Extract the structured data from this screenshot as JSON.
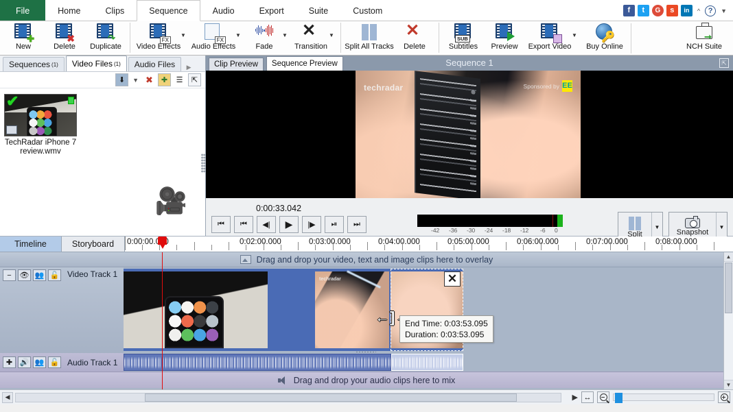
{
  "menubar": {
    "items": [
      "File",
      "Home",
      "Clips",
      "Sequence",
      "Audio",
      "Export",
      "Suite",
      "Custom"
    ],
    "active": "Sequence",
    "social": [
      "f",
      "t",
      "G",
      "s",
      "in"
    ],
    "help_label": "?"
  },
  "ribbon": {
    "buttons": [
      {
        "label": "New",
        "icon": "new-clip-icon"
      },
      {
        "label": "Delete",
        "icon": "delete-clip-icon"
      },
      {
        "label": "Duplicate",
        "icon": "duplicate-clip-icon"
      },
      {
        "label": "Video Effects",
        "icon": "video-effects-icon"
      },
      {
        "label": "Audio Effects",
        "icon": "audio-effects-icon"
      },
      {
        "label": "Fade",
        "icon": "fade-icon"
      },
      {
        "label": "Transition",
        "icon": "transition-icon"
      },
      {
        "label": "Split All Tracks",
        "icon": "split-all-tracks-icon"
      },
      {
        "label": "Delete",
        "icon": "delete-x-icon"
      },
      {
        "label": "Subtitles",
        "icon": "subtitles-icon"
      },
      {
        "label": "Preview",
        "icon": "preview-icon"
      },
      {
        "label": "Export Video",
        "icon": "export-video-icon"
      },
      {
        "label": "Buy Online",
        "icon": "buy-online-icon"
      },
      {
        "label": "NCH Suite",
        "icon": "nch-suite-icon"
      }
    ]
  },
  "bin": {
    "tabs": [
      {
        "label": "Sequences",
        "count": "(1)"
      },
      {
        "label": "Video Files",
        "count": "(1)"
      },
      {
        "label": "Audio Files",
        "count": ""
      }
    ],
    "active_tab": "Video Files",
    "tools": [
      "add-file-icon",
      "dropdown-icon",
      "remove-file-icon",
      "new-folder-icon",
      "list-view-icon",
      "detach-icon"
    ],
    "files": [
      {
        "name": "TechRadar iPhone 7 review.wmv",
        "selected": true
      }
    ]
  },
  "preview": {
    "tabs": [
      "Clip Preview",
      "Sequence Preview"
    ],
    "active_tab": "Sequence Preview",
    "title": "Sequence 1",
    "timecode": "0:00:33.042",
    "transport": [
      "skip-start",
      "step-back-frame",
      "prev-frame",
      "play",
      "next-frame",
      "step-forward-frame",
      "skip-end"
    ],
    "video_watermark": "techradar",
    "video_sponsor": "Sponsored by",
    "video_sponsor_brand": "EE",
    "meter": {
      "ticks": [
        "-42",
        "-36",
        "-30",
        "-24",
        "-18",
        "-12",
        "-6",
        "0"
      ]
    },
    "buttons": [
      {
        "label": "Split",
        "icon": "split-icon"
      },
      {
        "label": "Snapshot",
        "icon": "camera-icon"
      }
    ]
  },
  "timeline": {
    "tabs": [
      "Timeline",
      "Storyboard"
    ],
    "active_tab": "Timeline",
    "ruler_labels": [
      "0:00:00.000",
      "0:02:00.000",
      "0:03:00.000",
      "0:04:00.000",
      "0:05:00.000",
      "0:06:00.000",
      "0:07:00.000",
      "0:08:00.000"
    ],
    "overlay_hint": "Drag and drop your video, text and image clips here to overlay",
    "mix_hint": "Drag and drop your audio clips here to mix",
    "video_track": {
      "name": "Video Track 1",
      "controls": [
        "collapse",
        "visibility",
        "group",
        "lock"
      ]
    },
    "audio_track": {
      "name": "Audio Track 1",
      "controls": [
        "add",
        "mute",
        "group",
        "lock"
      ]
    },
    "tooltip": {
      "end_time": "End Time: 0:03:53.095",
      "duration": "Duration: 0:03:53.095"
    },
    "transition_icon": "transition-x-icon",
    "zoom_controls": [
      "scroll-right",
      "fit-width-icon",
      "zoom-out-icon",
      "zoom-slider",
      "zoom-in-icon"
    ]
  },
  "colors": {
    "accent_green": "#1e7145",
    "playhead": "#e00d0d",
    "clip_blue": "#4a6bb5",
    "timeline_bg": "#a9b6c8"
  }
}
